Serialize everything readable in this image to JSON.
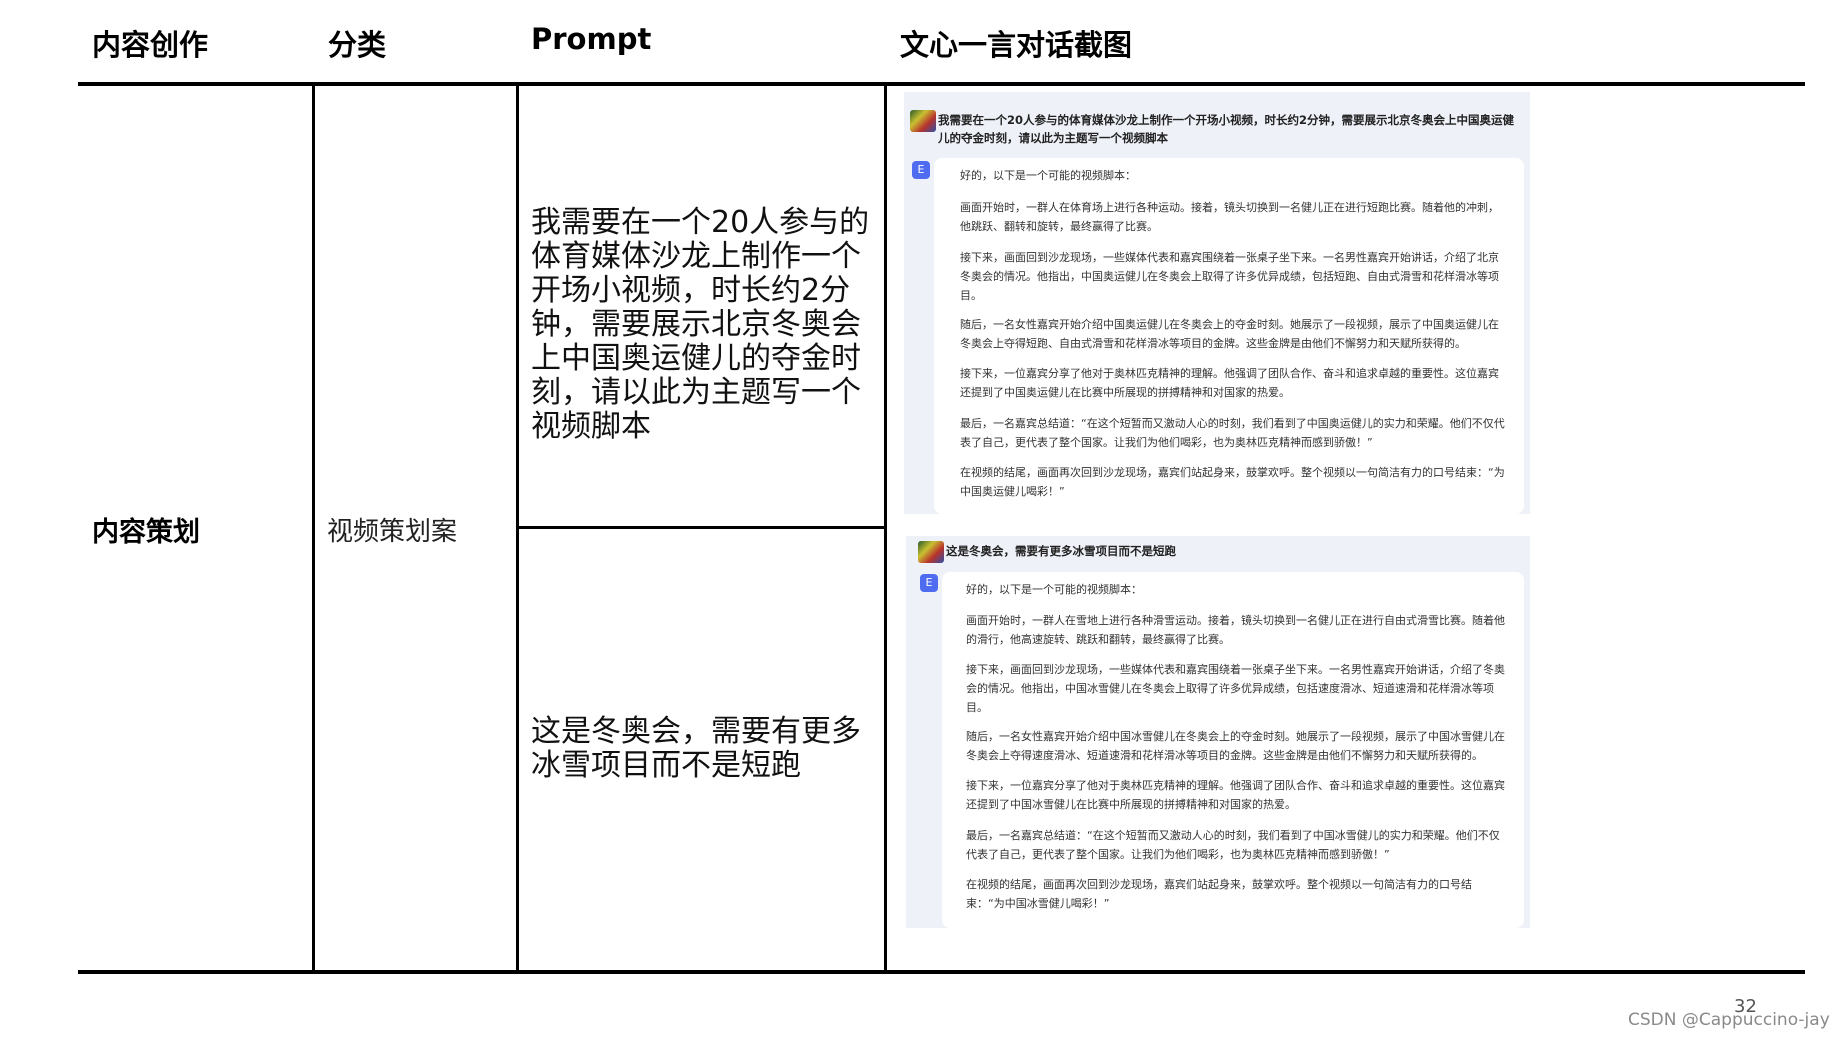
{
  "headers": {
    "col1": "内容创作",
    "col2": "分类",
    "col3": "Prompt",
    "col4": "文心一言对话截图"
  },
  "row": {
    "col1": "内容策划",
    "col2": "视频策划案",
    "prompt1": "我需要在一个20人参与的体育媒体沙龙上制作一个开场小视频，时长约2分钟，需要展示北京冬奥会上中国奥运健儿的夺金时刻，请以此为主题写一个视频脚本",
    "prompt2": "这是冬奥会，需要有更多冰雪项目而不是短跑"
  },
  "shot1": {
    "question": "我需要在一个20人参与的体育媒体沙龙上制作一个开场小视频，时长约2分钟，需要展示北京冬奥会上中国奥运健儿的夺金时刻，请以此为主题写一个视频脚本",
    "badge": "E",
    "paragraphs": [
      "好的，以下是一个可能的视频脚本：",
      "画面开始时，一群人在体育场上进行各种运动。接着，镜头切换到一名健儿正在进行短跑比赛。随着他的冲刺，他跳跃、翻转和旋转，最终赢得了比赛。",
      "接下来，画面回到沙龙现场，一些媒体代表和嘉宾围绕着一张桌子坐下来。一名男性嘉宾开始讲话，介绍了北京冬奥会的情况。他指出，中国奥运健儿在冬奥会上取得了许多优异成绩，包括短跑、自由式滑雪和花样滑冰等项目。",
      "随后，一名女性嘉宾开始介绍中国奥运健儿在冬奥会上的夺金时刻。她展示了一段视频，展示了中国奥运健儿在冬奥会上夺得短跑、自由式滑雪和花样滑冰等项目的金牌。这些金牌是由他们不懈努力和天赋所获得的。",
      "接下来，一位嘉宾分享了他对于奥林匹克精神的理解。他强调了团队合作、奋斗和追求卓越的重要性。这位嘉宾还提到了中国奥运健儿在比赛中所展现的拼搏精神和对国家的热爱。",
      "最后，一名嘉宾总结道：“在这个短暂而又激动人心的时刻，我们看到了中国奥运健儿的实力和荣耀。他们不仅代表了自己，更代表了整个国家。让我们为他们喝彩，也为奥林匹克精神而感到骄傲！”",
      "在视频的结尾，画面再次回到沙龙现场，嘉宾们站起身来，鼓掌欢呼。整个视频以一句简洁有力的口号结束：“为中国奥运健儿喝彩！”"
    ]
  },
  "shot2": {
    "question": "这是冬奥会，需要有更多冰雪项目而不是短跑",
    "badge": "E",
    "paragraphs": [
      "好的，以下是一个可能的视频脚本：",
      "画面开始时，一群人在雪地上进行各种滑雪运动。接着，镜头切换到一名健儿正在进行自由式滑雪比赛。随着他的滑行，他高速旋转、跳跃和翻转，最终赢得了比赛。",
      "接下来，画面回到沙龙现场，一些媒体代表和嘉宾围绕着一张桌子坐下来。一名男性嘉宾开始讲话，介绍了冬奥会的情况。他指出，中国冰雪健儿在冬奥会上取得了许多优异成绩，包括速度滑冰、短道速滑和花样滑冰等项目。",
      "随后，一名女性嘉宾开始介绍中国冰雪健儿在冬奥会上的夺金时刻。她展示了一段视频，展示了中国冰雪健儿在冬奥会上夺得速度滑冰、短道速滑和花样滑冰等项目的金牌。这些金牌是由他们不懈努力和天赋所获得的。",
      "接下来，一位嘉宾分享了他对于奥林匹克精神的理解。他强调了团队合作、奋斗和追求卓越的重要性。这位嘉宾还提到了中国冰雪健儿在比赛中所展现的拼搏精神和对国家的热爱。",
      "最后，一名嘉宾总结道：“在这个短暂而又激动人心的时刻，我们看到了中国冰雪健儿的实力和荣耀。他们不仅代表了自己，更代表了整个国家。让我们为他们喝彩，也为奥林匹克精神而感到骄傲！”",
      "在视频的结尾，画面再次回到沙龙现场，嘉宾们站起身来，鼓掌欢呼。整个视频以一句简洁有力的口号结束：“为中国冰雪健儿喝彩！”"
    ]
  },
  "page_number": "32",
  "watermark": "CSDN @Cappuccino-jay",
  "colors": {
    "rule": "#000000",
    "screenshot_bg": "#eef1f8",
    "badge": "#4f6bf0"
  }
}
